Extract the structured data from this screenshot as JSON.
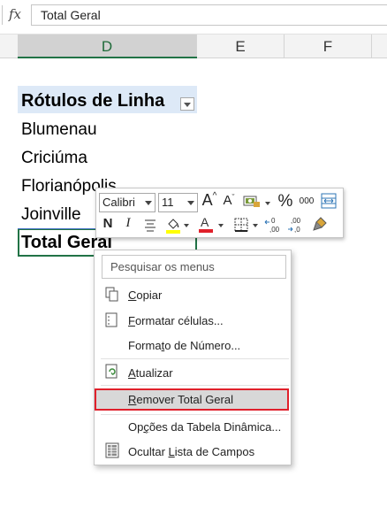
{
  "formula_bar": {
    "fx_label": "fx",
    "value": "Total Geral"
  },
  "columns": [
    "D",
    "E",
    "F"
  ],
  "pivot": {
    "header": "Rótulos de Linha",
    "rows": [
      "Blumenau",
      "Criciúma",
      "Florianópolis",
      "Joinville"
    ],
    "total": "Total Geral"
  },
  "mini_toolbar": {
    "font_name": "Calibri",
    "font_size": "11",
    "bold": "N",
    "italic": "I",
    "percent": "%",
    "thousands": "000",
    "font_color": "#e0202b",
    "highlight_color": "#ffff00"
  },
  "context_menu": {
    "search_placeholder": "Pesquisar os menus",
    "items": [
      {
        "pre": "",
        "u": "C",
        "post": "opiar",
        "icon": "copy-icon"
      },
      {
        "pre": "",
        "u": "F",
        "post": "ormatar células...",
        "icon": "format-cells-icon"
      },
      {
        "pre": "Forma",
        "u": "t",
        "post": "o de Número...",
        "icon": ""
      },
      {
        "pre": "",
        "u": "A",
        "post": "tualizar",
        "icon": "refresh-icon"
      },
      {
        "pre": "",
        "u": "R",
        "post": "emover Total Geral",
        "icon": ""
      },
      {
        "pre": "Op",
        "u": "ç",
        "post": "ões da Tabela Dinâmica...",
        "icon": ""
      },
      {
        "pre": "Ocultar ",
        "u": "L",
        "post": "ista de Campos",
        "icon": "field-list-icon"
      }
    ]
  }
}
